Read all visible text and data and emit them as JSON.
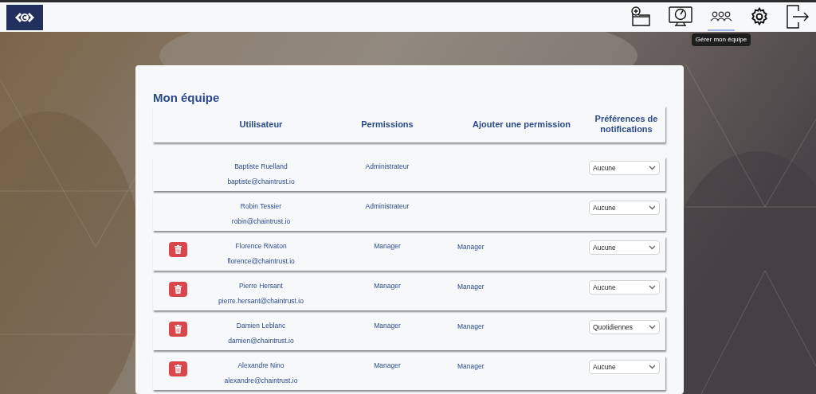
{
  "header": {
    "nav": [
      {
        "kind": "folder-add",
        "selected": false
      },
      {
        "kind": "dashboard",
        "selected": false
      },
      {
        "kind": "team",
        "selected": true,
        "tooltip": "Gérer mon équipe"
      },
      {
        "kind": "settings",
        "selected": false
      },
      {
        "kind": "logout",
        "selected": false
      }
    ]
  },
  "team": {
    "title": "Mon équipe",
    "columns": [
      "Utilisateur",
      "Permissions",
      "Ajouter une permission",
      "Préférences de notifications"
    ],
    "rows": [
      {
        "deletable": false,
        "name": "Baptiste Ruelland",
        "email": "baptiste@chaintrust.io",
        "permission": "Administrateur",
        "notifications": "Aucune"
      },
      {
        "deletable": false,
        "name": "Robin Tessier",
        "email": "robin@chaintrust.io",
        "permission": "Administrateur",
        "notifications": "Aucune"
      },
      {
        "deletable": true,
        "name": "Florence Rivaton",
        "email": "florence@chaintrust.io",
        "permission": "Manager",
        "added_permission": "Manager",
        "notifications": "Aucune"
      },
      {
        "deletable": true,
        "name": "Pierre Hersant",
        "email": "pierre.hersant@chaintrust.io",
        "permission": "Manager",
        "added_permission": "Manager",
        "notifications": "Aucune"
      },
      {
        "deletable": true,
        "name": "Damien Leblanc",
        "email": "damien@chaintrust.io",
        "permission": "Manager",
        "added_permission": "Manager",
        "notifications": "Quotidiennes"
      },
      {
        "deletable": true,
        "name": "Alexandre Nino",
        "email": "alexandre@chaintrust.io",
        "permission": "Manager",
        "added_permission": "Manager",
        "notifications": "Aucune"
      }
    ]
  }
}
